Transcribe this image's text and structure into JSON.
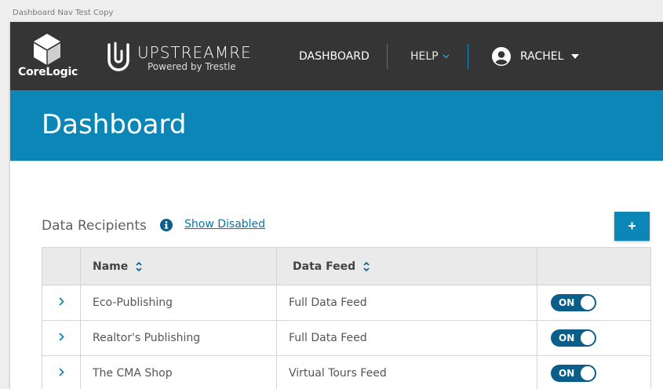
{
  "window": {
    "title": "Dashboard Nav Test Copy"
  },
  "header": {
    "corelogic_label": "CoreLogic",
    "upstream_name": "UPSTREAMRE",
    "upstream_tagline": "Powered by Trestle",
    "nav_dashboard": "DASHBOARD",
    "nav_help": "HELP",
    "user_name": "RACHEL"
  },
  "banner": {
    "title": "Dashboard"
  },
  "section": {
    "title": "Data Recipients",
    "show_disabled": "Show Disabled",
    "add_label": "+"
  },
  "table": {
    "columns": [
      "Name",
      "Data Feed"
    ],
    "rows": [
      {
        "name": "Eco-Publishing",
        "feed": "Full Data Feed",
        "status": "ON"
      },
      {
        "name": "Realtor's Publishing",
        "feed": "Full Data Feed",
        "status": "ON"
      },
      {
        "name": "The CMA Shop",
        "feed": "Virtual Tours Feed",
        "status": "ON"
      }
    ]
  },
  "colors": {
    "topbar": "#353535",
    "accent": "#0b86b7",
    "toggle_on": "#0b5e8a"
  },
  "icons": [
    "corelogic-logo-icon",
    "upstream-logo-icon",
    "chevron-down-icon",
    "user-avatar-icon",
    "caret-down-icon",
    "info-icon",
    "sort-icon",
    "chevron-right-icon"
  ]
}
